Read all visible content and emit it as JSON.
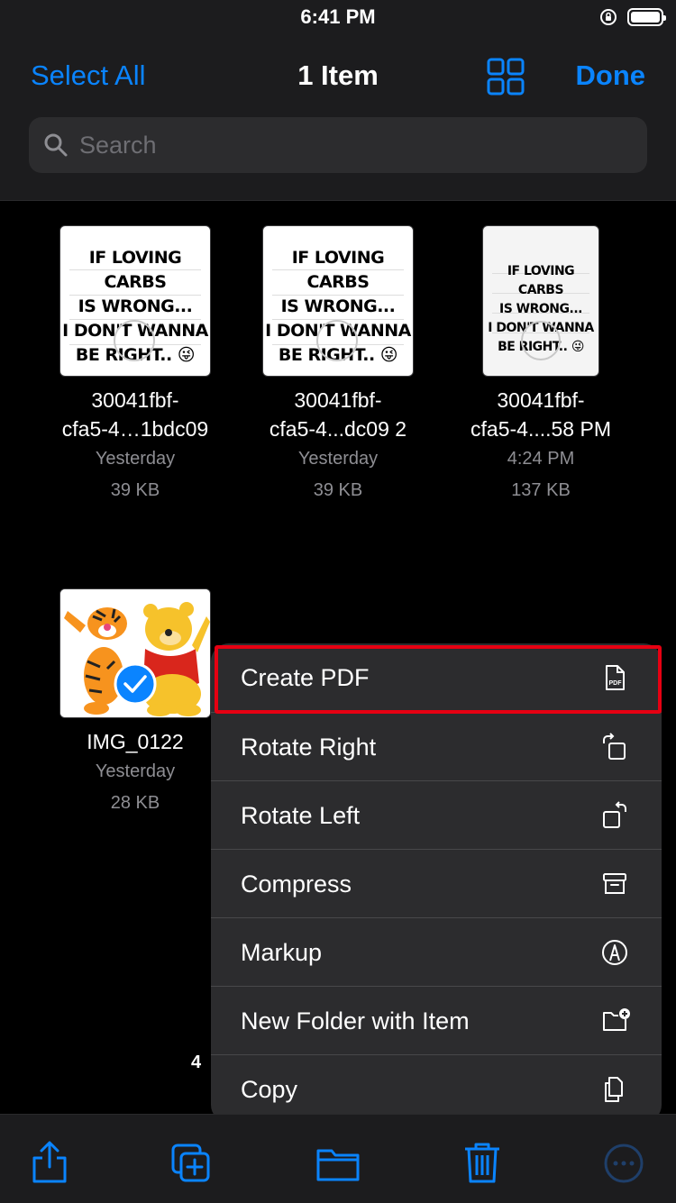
{
  "status_bar": {
    "time": "6:41 PM"
  },
  "nav": {
    "select_all": "Select All",
    "title": "1 Item",
    "done": "Done"
  },
  "search": {
    "placeholder": "Search"
  },
  "files": [
    {
      "thumb_lines": [
        "IF LOVING CARBS",
        "IS WRONG...",
        "I DON'T WANNA",
        "BE RIGHT.. 😜"
      ],
      "name_line1": "30041fbf-",
      "name_line2": "cfa5-4…1bdc09",
      "date": "Yesterday",
      "size": "39 KB"
    },
    {
      "thumb_lines": [
        "IF LOVING CARBS",
        "IS WRONG...",
        "I DON'T WANNA",
        "BE RIGHT.. 😜"
      ],
      "name_line1": "30041fbf-",
      "name_line2": "cfa5-4...dc09 2",
      "date": "Yesterday",
      "size": "39 KB"
    },
    {
      "thumb_lines": [
        "IF LOVING CARBS",
        "IS WRONG...",
        "I DON'T WANNA",
        "BE RIGHT.. 😜"
      ],
      "name_line1": "30041fbf-",
      "name_line2": "cfa5-4....58 PM",
      "date": "4:24 PM",
      "size": "137 KB"
    },
    {
      "name_line1": "IMG_0122",
      "date": "Yesterday",
      "size": "28 KB",
      "selected": true
    }
  ],
  "item_count_badge": "4",
  "menu": {
    "items": [
      {
        "label": "Create PDF",
        "icon": "pdf-document-icon"
      },
      {
        "label": "Rotate Right",
        "icon": "rotate-right-icon"
      },
      {
        "label": "Rotate Left",
        "icon": "rotate-left-icon"
      },
      {
        "label": "Compress",
        "icon": "archive-box-icon"
      },
      {
        "label": "Markup",
        "icon": "markup-pen-icon"
      },
      {
        "label": "New Folder with Item",
        "icon": "folder-plus-icon"
      },
      {
        "label": "Copy",
        "icon": "copy-documents-icon"
      }
    ],
    "highlighted": "Create PDF"
  },
  "toolbar": {
    "icons": [
      "share-icon",
      "duplicate-icon",
      "move-folder-icon",
      "trash-icon",
      "more-icon"
    ]
  },
  "colors": {
    "accent": "#0a84ff",
    "highlight_border": "#e60012",
    "background": "#000000",
    "bar": "#1c1c1e",
    "menu": "#2c2c2e"
  }
}
